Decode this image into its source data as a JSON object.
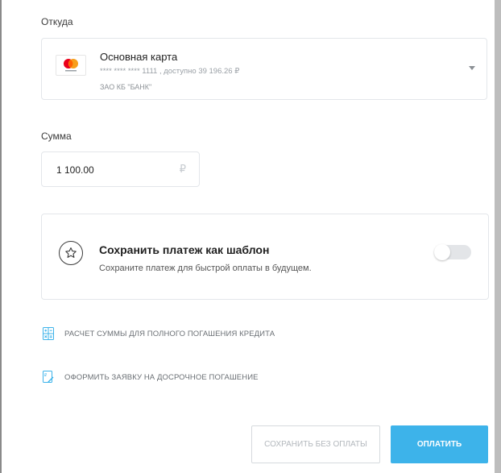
{
  "source": {
    "label": "Откуда",
    "card": {
      "name": "Основная карта",
      "details": "**** **** **** 1111 , доступно 39 196.26 ₽",
      "bank": "ЗАО КБ \"БАНК\"",
      "logo_icon": "mastercard-icon",
      "dropdown_icon": "chevron-down-icon"
    }
  },
  "amount": {
    "label": "Сумма",
    "value": "1 100.00",
    "currency_symbol": "₽"
  },
  "template": {
    "icon": "star-icon",
    "title": "Сохранить платеж как шаблон",
    "subtitle": "Сохраните платеж для быстрой оплаты в будущем.",
    "toggle_on": false
  },
  "links": [
    {
      "icon": "calculator-icon",
      "label": "РАСЧЕТ СУММЫ ДЛЯ ПОЛНОГО ПОГАШЕНИЯ КРЕДИТА"
    },
    {
      "icon": "document-edit-icon",
      "label": "ОФОРМИТЬ ЗАЯВКУ НА ДОСРОЧНОЕ ПОГАШЕНИЕ"
    }
  ],
  "actions": {
    "save_without_payment": "СОХРАНИТЬ БЕЗ ОПЛАТЫ",
    "pay": "ОПЛАТИТЬ"
  },
  "colors": {
    "accent": "#3db3ea",
    "border": "#e3e6ea",
    "muted_text": "#9aa0a6"
  }
}
